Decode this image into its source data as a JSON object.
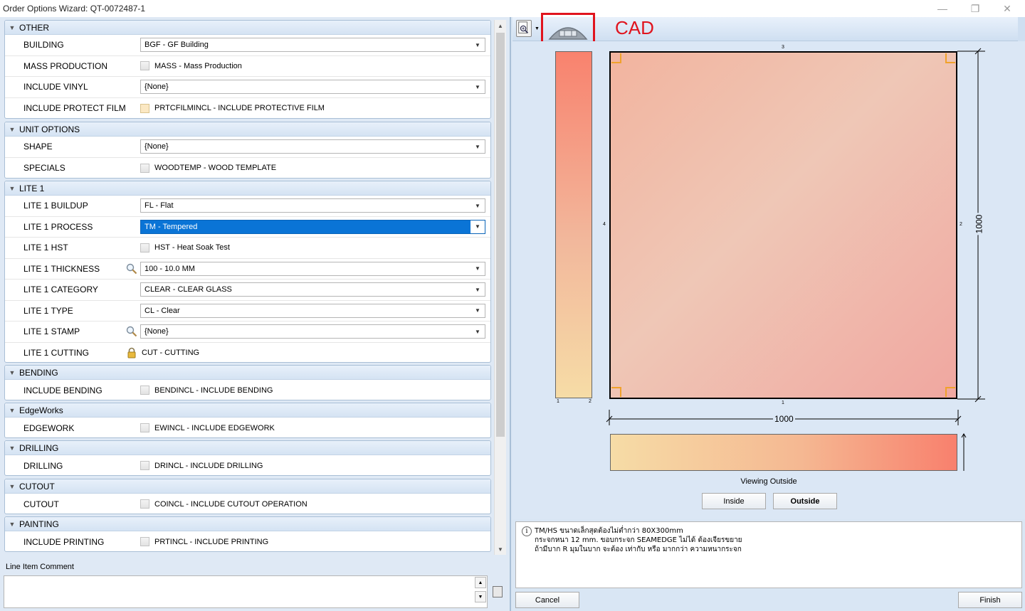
{
  "window": {
    "title": "Order Options Wizard: QT-0072487-1",
    "minimize_glyph": "—",
    "restore_glyph": "❐",
    "close_glyph": "✕"
  },
  "groups": {
    "other": {
      "name": "OTHER",
      "building": {
        "label": "BUILDING",
        "value": "BGF - GF Building"
      },
      "mass": {
        "label": "MASS PRODUCTION",
        "value": "MASS - Mass Production"
      },
      "vinyl": {
        "label": "INCLUDE VINYL",
        "value": "{None}"
      },
      "film": {
        "label": "INCLUDE PROTECT FILM",
        "value": "PRTCFILMINCL - INCLUDE PROTECTIVE FILM"
      }
    },
    "unit": {
      "name": "UNIT OPTIONS",
      "shape": {
        "label": "SHAPE",
        "value": "{None}"
      },
      "specials": {
        "label": "SPECIALS",
        "value": "WOODTEMP - WOOD TEMPLATE"
      }
    },
    "lite1": {
      "name": "LITE 1",
      "buildup": {
        "label": "LITE 1 BUILDUP",
        "value": "FL - Flat"
      },
      "process": {
        "label": "LITE 1 PROCESS",
        "value": "TM - Tempered"
      },
      "hst": {
        "label": "LITE 1 HST",
        "value": "HST - Heat Soak Test"
      },
      "thickness": {
        "label": "LITE 1 THICKNESS",
        "value": "100 - 10.0 MM"
      },
      "category": {
        "label": "LITE 1 CATEGORY",
        "value": "CLEAR - CLEAR GLASS"
      },
      "type": {
        "label": "LITE 1 TYPE",
        "value": "CL - Clear"
      },
      "stamp": {
        "label": "LITE 1 STAMP",
        "value": "{None}"
      },
      "cutting": {
        "label": "LITE 1 CUTTING",
        "value": "CUT - CUTTING"
      }
    },
    "bending": {
      "name": "BENDING",
      "include": {
        "label": "INCLUDE BENDING",
        "value": "BENDINCL - INCLUDE BENDING"
      }
    },
    "edgeworks": {
      "name": "EdgeWorks",
      "edgework": {
        "label": "EDGEWORK",
        "value": "EWINCL - INCLUDE EDGEWORK"
      }
    },
    "drilling": {
      "name": "DRILLING",
      "drilling": {
        "label": "DRILLING",
        "value": "DRINCL - INCLUDE DRILLING"
      }
    },
    "cutout": {
      "name": "CUTOUT",
      "cutout": {
        "label": "CUTOUT",
        "value": "COINCL - INCLUDE CUTOUT OPERATION"
      }
    },
    "painting": {
      "name": "PAINTING",
      "printing": {
        "label": "INCLUDE PRINTING",
        "value": "PRTINCL - INCLUDE PRINTING"
      }
    }
  },
  "comment": {
    "label": "Line Item Comment",
    "value": ""
  },
  "cad": {
    "label": "CAD",
    "width_dim": "1000",
    "height_dim": "1000",
    "edge_top": "3",
    "edge_bottom": "1",
    "edge_left": "4",
    "edge_right": "2",
    "side_marks": [
      "1",
      "2"
    ],
    "viewing": "Viewing Outside",
    "inside_button": "Inside",
    "outside_button": "Outside"
  },
  "message": {
    "line1": "TM/HS ขนาดเล็กสุดต้องไม่ต่ำกว่า 80X300mm",
    "line2": "กระจกหนา 12 mm. ขอบกระจก SEAMEDGE ไม่ได้ ต้องเจียรขยาย",
    "line3": "ถ้ามีบาก R มุมในบาก จะต้อง เท่ากับ หรือ มากกว่า ความหนากระจก"
  },
  "buttons": {
    "cancel": "Cancel",
    "finish": "Finish"
  },
  "colors": {
    "accent": "#0a74d6",
    "highlight_box": "#e0141e",
    "corner_marks": "#f0a22b"
  }
}
